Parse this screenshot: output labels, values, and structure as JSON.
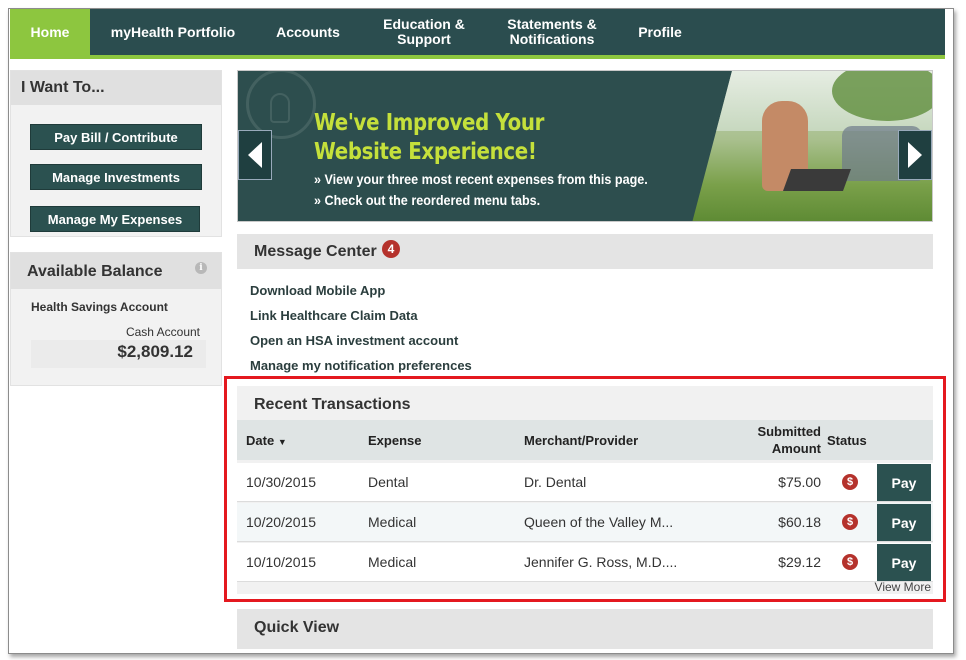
{
  "nav": {
    "items": [
      {
        "label": "Home"
      },
      {
        "label": "myHealth Portfolio"
      },
      {
        "label": "Accounts"
      },
      {
        "label": "Education & Support"
      },
      {
        "label": "Statements & Notifications"
      },
      {
        "label": "Profile"
      }
    ],
    "active": "Home"
  },
  "want_to": {
    "title": "I Want To...",
    "buttons": [
      {
        "label": "Pay Bill / Contribute"
      },
      {
        "label": "Manage Investments"
      },
      {
        "label": "Manage My Expenses"
      }
    ]
  },
  "balance": {
    "title": "Available Balance",
    "info_icon": "info-icon",
    "account_name": "Health Savings Account",
    "cash_label": "Cash Account",
    "cash_value": "$2,809.12"
  },
  "banner": {
    "headline_line1": "We've Improved Your",
    "headline_line2": "Website Experience!",
    "bullet1": "» View your three most recent expenses from this page.",
    "bullet2": "» Check out the reordered menu tabs."
  },
  "message_center": {
    "title": "Message Center",
    "count": "4",
    "links": [
      {
        "label": "Download Mobile App"
      },
      {
        "label": "Link Healthcare Claim Data"
      },
      {
        "label": "Open an HSA investment account"
      },
      {
        "label": "Manage my notification preferences"
      }
    ]
  },
  "transactions": {
    "title": "Recent Transactions",
    "columns": {
      "date": "Date",
      "expense": "Expense",
      "merchant": "Merchant/Provider",
      "amount_line1": "Submitted",
      "amount_line2": "Amount",
      "status": "Status"
    },
    "rows": [
      {
        "date": "10/30/2015",
        "expense": "Dental",
        "merchant": "Dr. Dental",
        "amount": "$75.00",
        "status_icon": "$",
        "action": "Pay"
      },
      {
        "date": "10/20/2015",
        "expense": "Medical",
        "merchant": "Queen of the Valley M...",
        "amount": "$60.18",
        "status_icon": "$",
        "action": "Pay"
      },
      {
        "date": "10/10/2015",
        "expense": "Medical",
        "merchant": "Jennifer G. Ross, M.D....",
        "amount": "$29.12",
        "status_icon": "$",
        "action": "Pay"
      }
    ],
    "view_more": "View More"
  },
  "quick_view": {
    "title": "Quick View"
  },
  "colors": {
    "nav_bg": "#2b4d4f",
    "accent_green": "#8dc63f",
    "button_teal": "#2b5150",
    "badge_red": "#b5322c",
    "highlight_red": "#e4181f",
    "banner_headline": "#c5e03b"
  }
}
